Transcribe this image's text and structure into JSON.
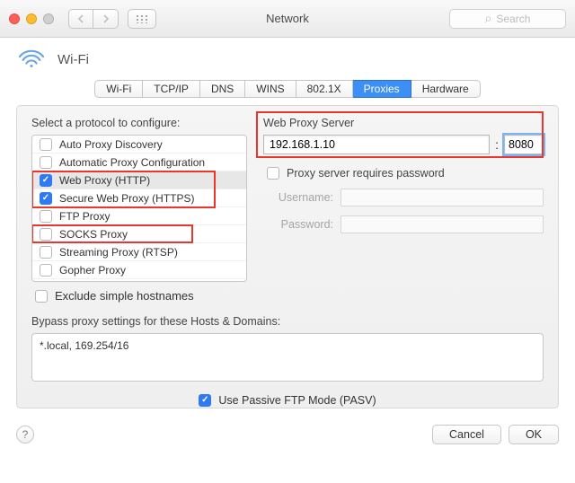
{
  "window": {
    "title": "Network",
    "search_placeholder": "Search"
  },
  "header": {
    "interface_name": "Wi-Fi"
  },
  "tabs": [
    {
      "label": "Wi-Fi",
      "active": false
    },
    {
      "label": "TCP/IP",
      "active": false
    },
    {
      "label": "DNS",
      "active": false
    },
    {
      "label": "WINS",
      "active": false
    },
    {
      "label": "802.1X",
      "active": false
    },
    {
      "label": "Proxies",
      "active": true
    },
    {
      "label": "Hardware",
      "active": false
    }
  ],
  "left": {
    "section_label": "Select a protocol to configure:",
    "protocols": [
      {
        "label": "Auto Proxy Discovery",
        "checked": false,
        "selected": false
      },
      {
        "label": "Automatic Proxy Configuration",
        "checked": false,
        "selected": false
      },
      {
        "label": "Web Proxy (HTTP)",
        "checked": true,
        "selected": true
      },
      {
        "label": "Secure Web Proxy (HTTPS)",
        "checked": true,
        "selected": false
      },
      {
        "label": "FTP Proxy",
        "checked": false,
        "selected": false
      },
      {
        "label": "SOCKS Proxy",
        "checked": false,
        "selected": false
      },
      {
        "label": "Streaming Proxy (RTSP)",
        "checked": false,
        "selected": false
      },
      {
        "label": "Gopher Proxy",
        "checked": false,
        "selected": false
      }
    ],
    "exclude_label": "Exclude simple hostnames",
    "exclude_checked": false
  },
  "right": {
    "title": "Web Proxy Server",
    "host": "192.168.1.10",
    "port": "8080",
    "requires_password_label": "Proxy server requires password",
    "requires_password_checked": false,
    "username_label": "Username:",
    "username_value": "",
    "password_label": "Password:",
    "password_value": ""
  },
  "bypass": {
    "label": "Bypass proxy settings for these Hosts & Domains:",
    "value": "*.local, 169.254/16"
  },
  "pasv": {
    "label": "Use Passive FTP Mode (PASV)",
    "checked": true
  },
  "footer": {
    "cancel": "Cancel",
    "ok": "OK"
  }
}
